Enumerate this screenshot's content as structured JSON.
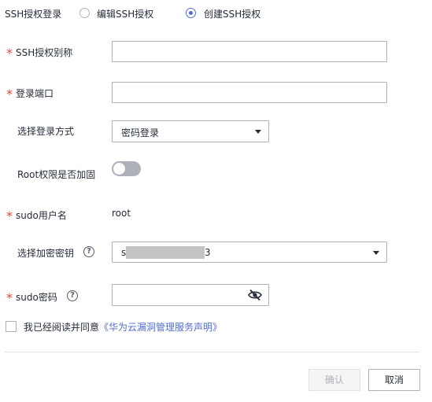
{
  "auth_login": {
    "label": "SSH授权登录",
    "options": [
      {
        "label": "编辑SSH授权",
        "selected": false
      },
      {
        "label": "创建SSH授权",
        "selected": true
      }
    ]
  },
  "form": {
    "alias": {
      "label": "SSH授权别称",
      "required": true,
      "value": ""
    },
    "port": {
      "label": "登录端口",
      "required": true,
      "value": ""
    },
    "login_method": {
      "label": "选择登录方式",
      "value": "密码登录"
    },
    "root_hardening": {
      "label": "Root权限是否加固",
      "enabled": false
    },
    "sudo_user": {
      "label": "sudo用户名",
      "required": true,
      "value": "root"
    },
    "encryption_key": {
      "label": "选择加密密钥",
      "value_prefix": "s",
      "value_suffix": "3"
    },
    "sudo_password": {
      "label": "sudo密码",
      "required": true,
      "value": ""
    }
  },
  "agreement": {
    "text": "我已经阅读并同意",
    "link": "《华为云漏洞管理服务声明》",
    "checked": false
  },
  "footer": {
    "confirm_label": "确认",
    "cancel_label": "取消"
  },
  "colors": {
    "accent": "#526ecc",
    "required": "#e6453c",
    "border": "#adb0b8"
  }
}
